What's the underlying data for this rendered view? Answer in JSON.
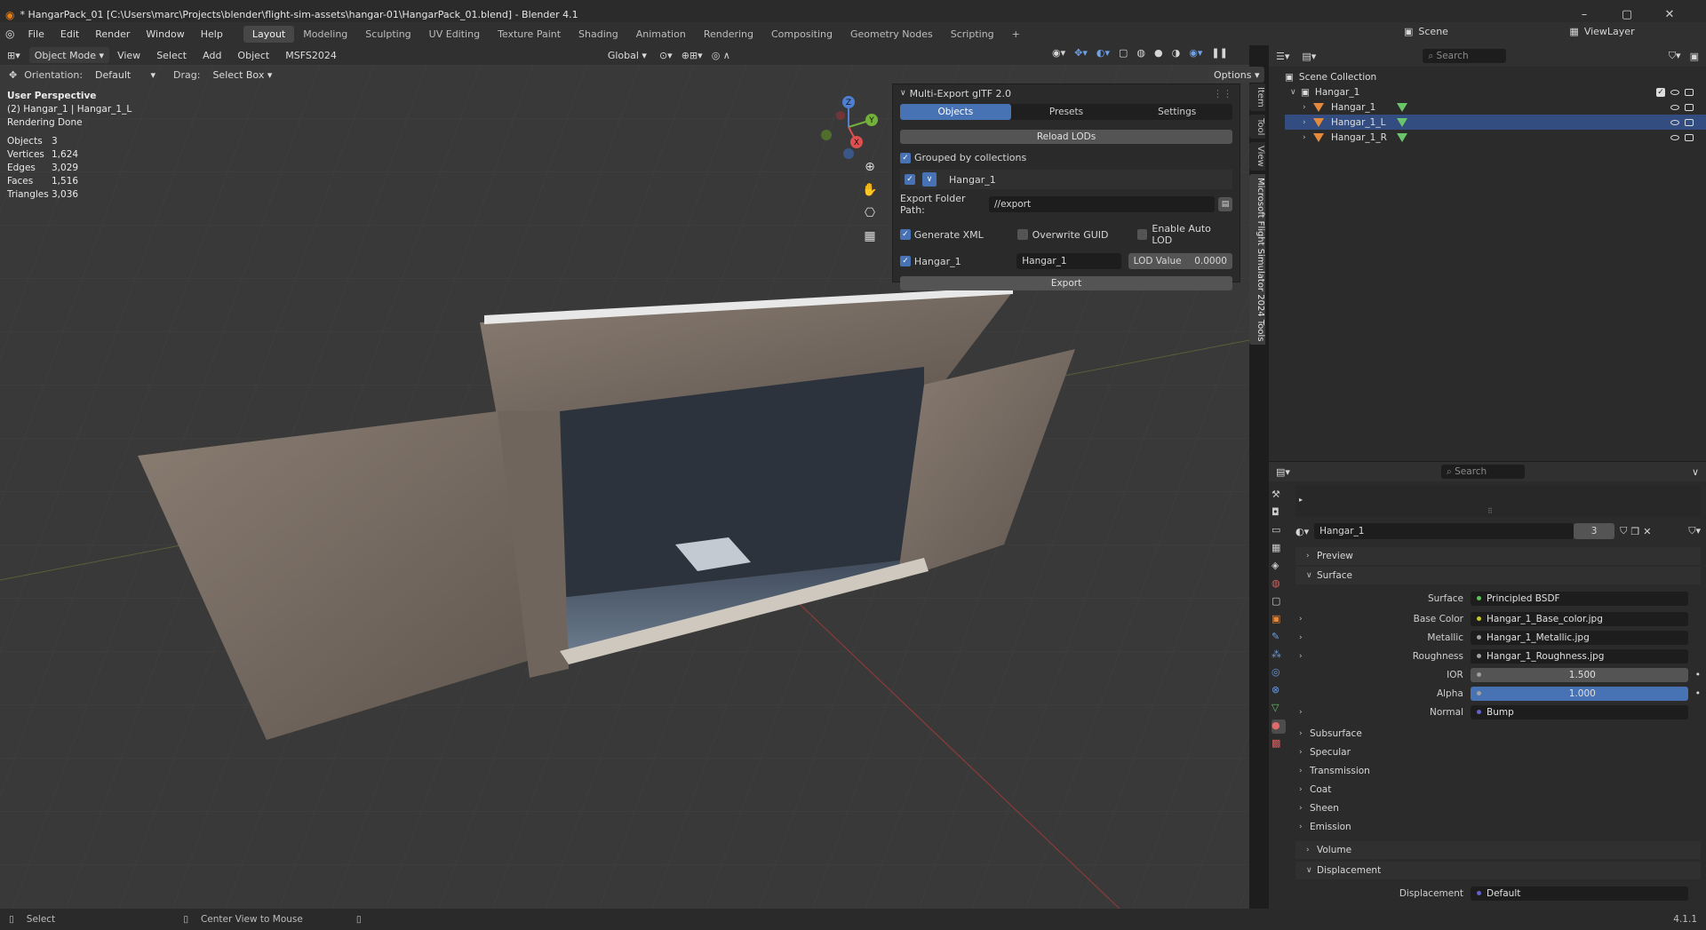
{
  "window": {
    "title": "* HangarPack_01 [C:\\Users\\marc\\Projects\\blender\\flight-sim-assets\\hangar-01\\HangarPack_01.blend] - Blender 4.1",
    "minimize": "–",
    "maximize": "▢",
    "close": "✕"
  },
  "menu": [
    "File",
    "Edit",
    "Render",
    "Window",
    "Help"
  ],
  "workspaces": [
    "Layout",
    "Modeling",
    "Sculpting",
    "UV Editing",
    "Texture Paint",
    "Shading",
    "Animation",
    "Rendering",
    "Compositing",
    "Geometry Nodes",
    "Scripting"
  ],
  "workspace_add": "+",
  "scene": {
    "name": "Scene",
    "view_layer": "ViewLayer"
  },
  "viewport_header": {
    "mode": "Object Mode",
    "menus": [
      "View",
      "Select",
      "Add",
      "Object",
      "MSFS2024"
    ],
    "transform": "Global",
    "options": "Options",
    "orientation_label": "Orientation:",
    "orientation_value": "Default",
    "drag_label": "Drag:",
    "drag_value": "Select Box"
  },
  "overlay_info": {
    "view": "User Perspective",
    "object": "(2) Hangar_1 | Hangar_1_L",
    "render": "Rendering Done",
    "stats": [
      {
        "label": "Objects",
        "value": "3"
      },
      {
        "label": "Vertices",
        "value": "1,624"
      },
      {
        "label": "Edges",
        "value": "3,029"
      },
      {
        "label": "Faces",
        "value": "1,516"
      },
      {
        "label": "Triangles",
        "value": "3,036"
      }
    ]
  },
  "gizmo": {
    "x": "X",
    "y": "Y",
    "z": "Z"
  },
  "npanel": {
    "title": "Multi-Export glTF 2.0",
    "tabs": [
      "Objects",
      "Presets",
      "Settings"
    ],
    "reload": "Reload LODs",
    "grouped": "Grouped by collections",
    "collection": "Hangar_1",
    "folder_label": "Export Folder Path:",
    "folder_value": "//export",
    "generate_xml": "Generate XML",
    "overwrite_guid": "Overwrite GUID",
    "auto_lod": "Enable Auto LOD",
    "obj_name": "Hangar_1",
    "obj_field": "Hangar_1",
    "lod_label": "LOD Value",
    "lod_value": "0.0000",
    "export": "Export"
  },
  "side_tabs": [
    "Item",
    "Tool",
    "View",
    "Microsoft Flight Simulator 2024 Tools"
  ],
  "outliner": {
    "search_placeholder": "Search",
    "root": "Scene Collection",
    "collection": "Hangar_1",
    "objects": [
      "Hangar_1",
      "Hangar_1_L",
      "Hangar_1_R"
    ]
  },
  "properties": {
    "search_placeholder": "Search",
    "material": "Hangar_1",
    "users": "3",
    "preview": "Preview",
    "surface_section": "Surface",
    "rows": [
      {
        "label": "Surface",
        "value": "Principled BSDF",
        "dot": "#5ac25a"
      },
      {
        "label": "Base Color",
        "value": "Hangar_1_Base_color.jpg",
        "dot": "#c7c729"
      },
      {
        "label": "Metallic",
        "value": "Hangar_1_Metallic.jpg",
        "dot": "#a0a0a0"
      },
      {
        "label": "Roughness",
        "value": "Hangar_1_Roughness.jpg",
        "dot": "#a0a0a0"
      },
      {
        "label": "IOR",
        "value": "1.500",
        "dot": "#a0a0a0"
      },
      {
        "label": "Alpha",
        "value": "1.000",
        "dot": "#a0a0a0"
      },
      {
        "label": "Normal",
        "value": "Bump",
        "dot": "#6363c7"
      }
    ],
    "subsections": [
      "Subsurface",
      "Specular",
      "Transmission",
      "Coat",
      "Sheen",
      "Emission"
    ],
    "volume": "Volume",
    "displacement_section": "Displacement",
    "displacement_label": "Displacement",
    "displacement_value": "Default",
    "alpha_fill": 1.0
  },
  "status": {
    "select": "Select",
    "center": "Center View to Mouse",
    "version": "4.1.1"
  }
}
